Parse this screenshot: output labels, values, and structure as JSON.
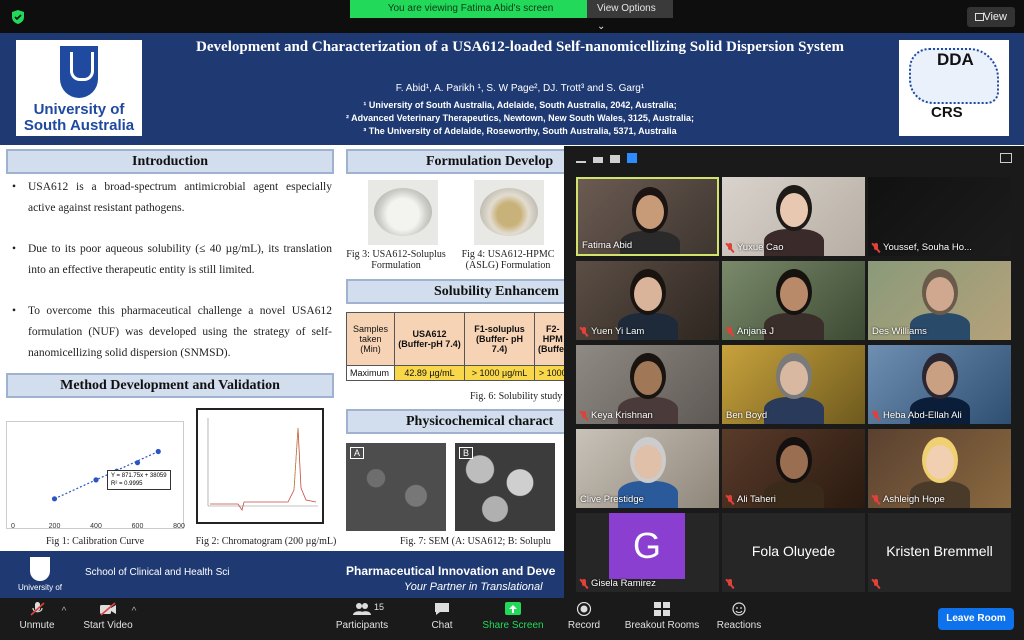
{
  "banner": {
    "message": "You are viewing Fatima Abid's screen",
    "view_options": "View Options ⌄",
    "view_button": "View"
  },
  "poster": {
    "logo_left": "University of South Australia",
    "logo_right_top": "DDA",
    "logo_right_bottom": "CRS",
    "title": "Development and Characterization of a USA612-loaded Self-nanomicellizing Solid Dispersion System",
    "authors": "F. Abid¹, A. Parikh ¹, S. W Page², DJ. Trott³ and S. Garg¹",
    "affiliations": [
      "¹ University of South Australia, Adelaide, South Australia, 2042, Australia;",
      "² Advanced Veterinary Therapeutics, Newtown, New South Wales, 3125, Australia;",
      "³ The University of Adelaide, Roseworthy, South Australia, 5371, Australia"
    ],
    "sections": {
      "introduction": "Introduction",
      "method": "Method Development and Validation",
      "formulation": "Formulation Develop",
      "solubility": "Solubility Enhancem",
      "physico": "Physicochemical charact"
    },
    "intro_points": [
      "USA612 is a broad-spectrum antimicrobial agent especially active against resistant pathogens.",
      "Due to its poor aqueous solubility (≤ 40 µg/mL), its translation into an effective therapeutic entity is still limited.",
      "To overcome this pharmaceutical challenge a novel USA612 formulation (NUF) was developed using the strategy of self-nanomicellizing solid dispersion (SNMSD)."
    ],
    "fig1": {
      "caption": "Fig 1: Calibration Curve",
      "x_ticks": [
        "0",
        "200",
        "400",
        "600",
        "800"
      ],
      "equation": "Y = 871.75x + 38059",
      "r2": "R² = 0.9995",
      "points": [
        [
          200,
          0.2
        ],
        [
          400,
          0.42
        ],
        [
          500,
          0.52
        ],
        [
          600,
          0.62
        ],
        [
          700,
          0.75
        ]
      ]
    },
    "fig2": {
      "caption": "Fig 2: Chromatogram (200 µg/mL)"
    },
    "fig3": {
      "caption": "Fig 3: USA612-Soluplus Formulation"
    },
    "fig4": {
      "caption": "Fig 4: USA612-HPMC (ASLG) Formulation"
    },
    "fig6": {
      "caption": "Fig. 6: Solubility study"
    },
    "fig7": {
      "caption": "Fig. 7: SEM (A: USA612; B: Soluplu",
      "label_a": "A",
      "label_b": "B"
    },
    "table": {
      "headers": [
        "Samples taken (Min)",
        "USA612 (Buffer-pH 7.4)",
        "F1-soluplus (Buffer- pH 7.4)",
        "F2-HPM (Buffer"
      ],
      "row": [
        "Maximum",
        "42.89 µg/mL",
        "> 1000 µg/mL",
        "> 1000"
      ]
    },
    "footer": {
      "logo_text": "University of",
      "school": "School of Clinical and Health Sci",
      "right_line1": "Pharmaceutical Innovation and Deve",
      "right_line2": "Your Partner in Translational"
    }
  },
  "participants": [
    {
      "name": "Fatima Abid",
      "muted": false,
      "video": true
    },
    {
      "name": "Yuxue Cao",
      "muted": true,
      "video": true
    },
    {
      "name": "Youssef, Souha Ho...",
      "muted": true,
      "video": true
    },
    {
      "name": "Yuen Yi Lam",
      "muted": true,
      "video": true
    },
    {
      "name": "Anjana J",
      "muted": true,
      "video": true
    },
    {
      "name": "Des Williams",
      "muted": false,
      "video": true
    },
    {
      "name": "Keya Krishnan",
      "muted": true,
      "video": true
    },
    {
      "name": "Ben Boyd",
      "muted": false,
      "video": true
    },
    {
      "name": "Heba Abd-Ellah Ali",
      "muted": true,
      "video": true
    },
    {
      "name": "Clive Prestidge",
      "muted": false,
      "video": true
    },
    {
      "name": "Ali Taheri",
      "muted": true,
      "video": true
    },
    {
      "name": "Ashleigh Hope",
      "muted": true,
      "video": true
    },
    {
      "name": "Gisela Ramirez",
      "muted": true,
      "video": false,
      "initial": "G"
    },
    {
      "name": "Fola Oluyede",
      "muted": true,
      "video": false
    },
    {
      "name": "Kristen Bremmell",
      "muted": true,
      "video": false
    }
  ],
  "toolbar": {
    "unmute": "Unmute",
    "start_video": "Start Video",
    "participants": "Participants",
    "participants_count": "15",
    "chat": "Chat",
    "share_screen": "Share Screen",
    "record": "Record",
    "breakout": "Breakout Rooms",
    "reactions": "Reactions",
    "leave": "Leave Room"
  },
  "colors": {
    "banner_green": "#23d959",
    "poster_blue": "#1f3a73",
    "active_speaker": "#d2e36b",
    "leave_blue": "#0e72ed",
    "muted_red": "#e0413b"
  }
}
